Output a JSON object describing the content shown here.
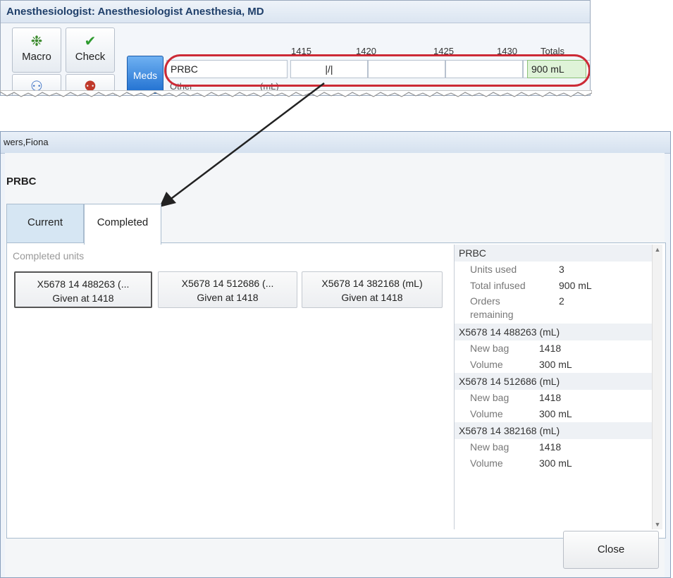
{
  "top_window": {
    "title": "Anesthesiologist: Anesthesiologist Anesthesia, MD",
    "toolbar": {
      "macro_label": "Macro",
      "check_label": "Check"
    },
    "meds_label": "Meds",
    "times": [
      "1415",
      "1420",
      "1425",
      "1430"
    ],
    "totals_label": "Totals",
    "med_row": {
      "name": "PRBC",
      "marker": "|/|",
      "total": "900 mL"
    },
    "next_row": {
      "name": "Other",
      "unit": "(mL)"
    }
  },
  "dialog": {
    "title": "wers,Fiona",
    "med_name": "PRBC",
    "tabs": {
      "current": "Current",
      "completed": "Completed"
    },
    "completed_units_label": "Completed units",
    "units": [
      {
        "line1": "X5678  14  488263 (...",
        "line2": "Given at 1418"
      },
      {
        "line1": "X5678  14  512686 (...",
        "line2": "Given at 1418"
      },
      {
        "line1": "X5678  14  382168 (mL)",
        "line2": "Given at 1418"
      }
    ],
    "summary": {
      "header": "PRBC",
      "units_used_label": "Units used",
      "units_used": "3",
      "total_infused_label": "Total infused",
      "total_infused": "900 mL",
      "orders_label_1": "Orders",
      "orders_label_2": "remaining",
      "orders_remaining": "2",
      "bags": [
        {
          "id": "X5678  14  488263 (mL)",
          "new_bag_label": "New bag",
          "new_bag": "1418",
          "volume_label": "Volume",
          "volume": "300 mL"
        },
        {
          "id": "X5678  14  512686 (mL)",
          "new_bag_label": "New bag",
          "new_bag": "1418",
          "volume_label": "Volume",
          "volume": "300 mL"
        },
        {
          "id": "X5678  14  382168 (mL)",
          "new_bag_label": "New bag",
          "new_bag": "1418",
          "volume_label": "Volume",
          "volume": "300 mL"
        }
      ]
    },
    "close_label": "Close"
  },
  "colors": {
    "highlight_oval": "#cc2a36",
    "meds_button": "#1f6fd0",
    "total_cell": "#dff3d8"
  }
}
